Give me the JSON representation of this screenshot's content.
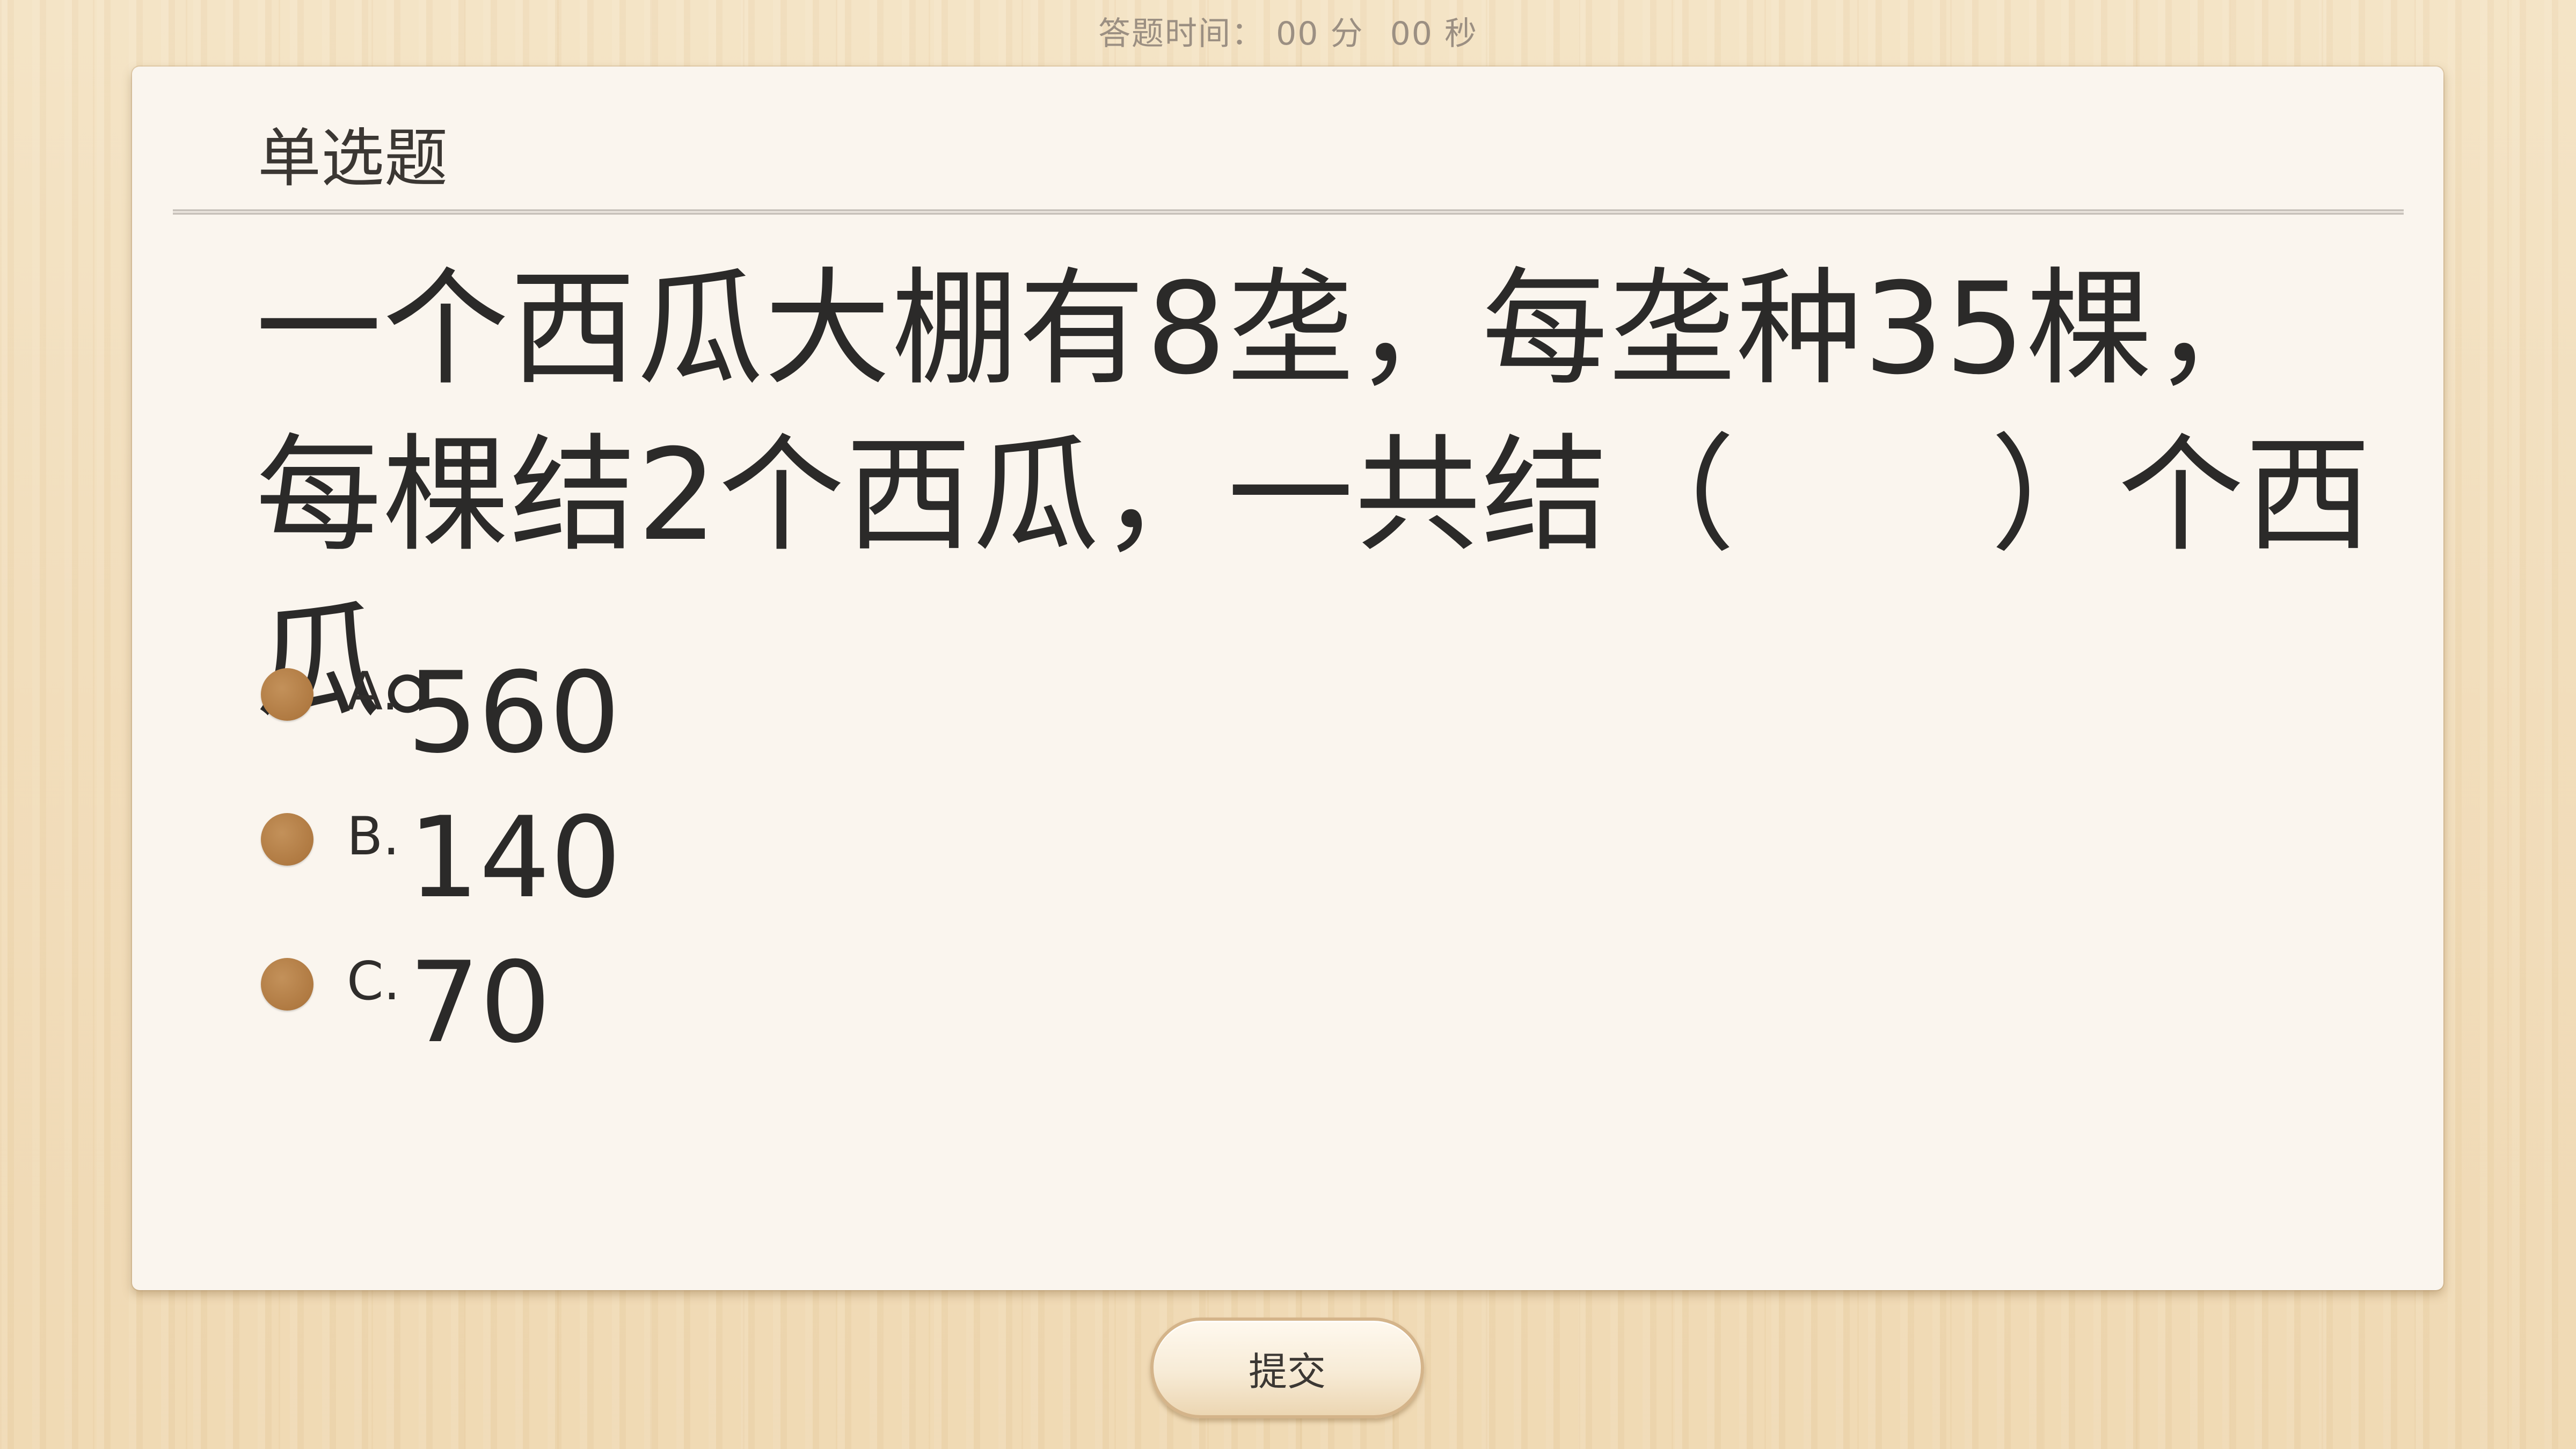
{
  "timer": {
    "label": "答题时间：",
    "minutes": "00",
    "minutes_unit": "分",
    "seconds": "00",
    "seconds_unit": "秒"
  },
  "question": {
    "type": "单选题",
    "text": "一个西瓜大棚有8垄，每垄种35棵，每棵结2个西瓜，一共结（　　）个西瓜。",
    "options": [
      {
        "letter": "A.",
        "value": "560"
      },
      {
        "letter": "B.",
        "value": "140"
      },
      {
        "letter": "C.",
        "value": "70"
      }
    ]
  },
  "submit": {
    "label": "提交"
  },
  "colors": {
    "background": "#f1ddbb",
    "card": "#faf5ee",
    "option_dot": "#b07a42",
    "text": "#2b2a29",
    "timer_text": "#9b8f82"
  },
  "icons": {
    "option_marker": "radio-dot-icon"
  }
}
